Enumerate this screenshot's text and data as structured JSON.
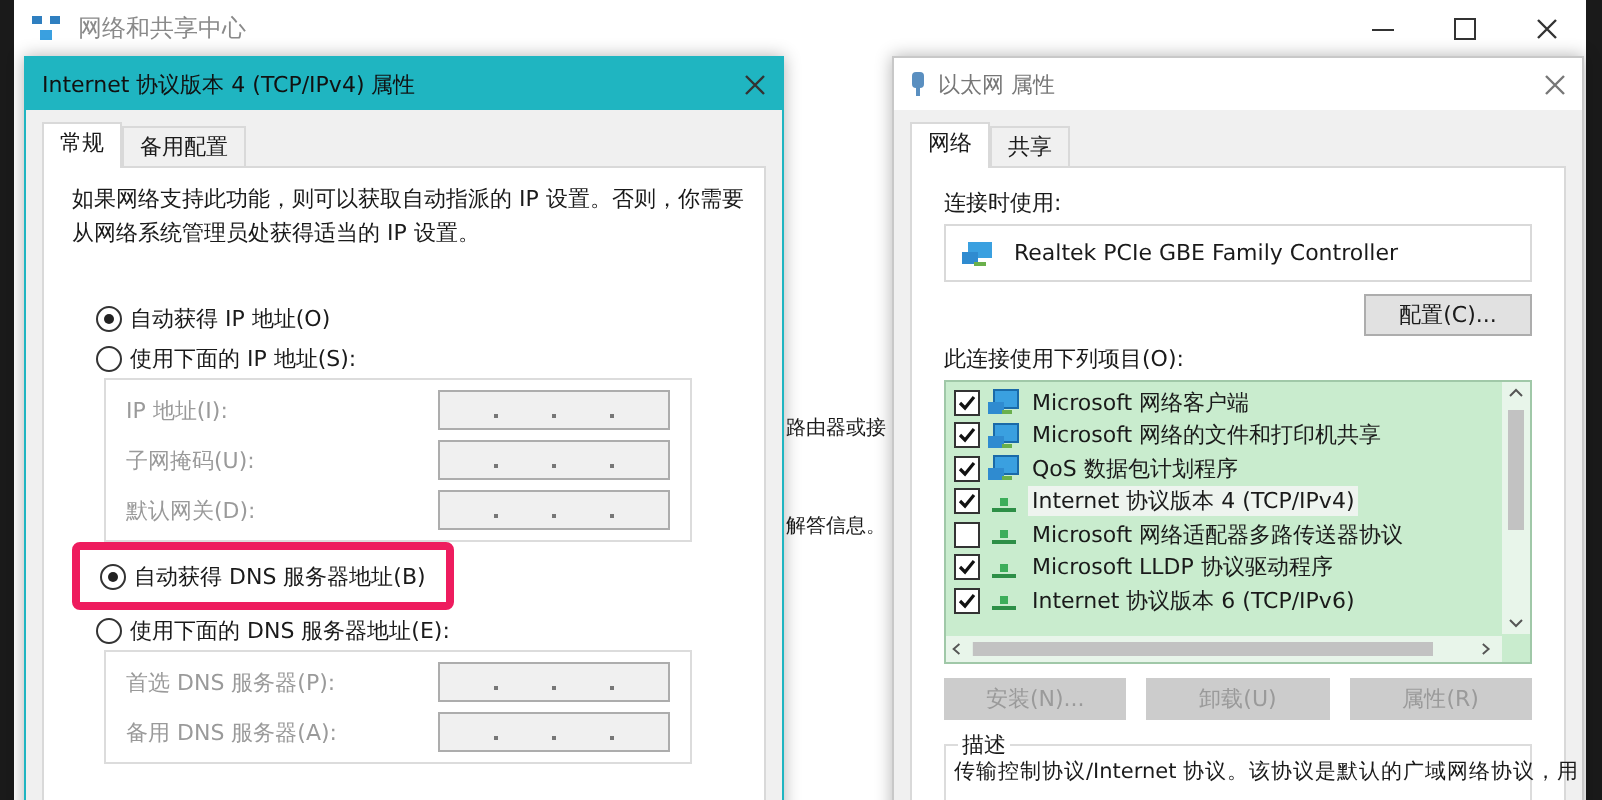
{
  "background_window": {
    "title": "网络和共享中心",
    "snippets": [
      "路由器或接",
      "解答信息。"
    ]
  },
  "ipv4_dialog": {
    "title": "Internet 协议版本 4 (TCP/IPv4) 属性",
    "tabs": [
      {
        "label": "常规",
        "selected": true
      },
      {
        "label": "备用配置",
        "selected": false
      }
    ],
    "intro": "如果网络支持此功能，则可以获取自动指派的 IP 设置。否则，你需要从网络系统管理员处获得适当的 IP 设置。",
    "ip_mode": [
      {
        "label": "自动获得 IP 地址(O)",
        "selected": true,
        "highlighted": false
      },
      {
        "label": "使用下面的 IP 地址(S):",
        "selected": false,
        "highlighted": false
      }
    ],
    "ip_fields": [
      {
        "label": "IP 地址(I):",
        "disabled": true
      },
      {
        "label": "子网掩码(U):",
        "disabled": true
      },
      {
        "label": "默认网关(D):",
        "disabled": true
      }
    ],
    "dns_mode": [
      {
        "label": "自动获得 DNS 服务器地址(B)",
        "selected": true,
        "highlighted": true
      },
      {
        "label": "使用下面的 DNS 服务器地址(E):",
        "selected": false,
        "highlighted": false
      }
    ],
    "dns_fields": [
      {
        "label": "首选 DNS 服务器(P):",
        "disabled": true
      },
      {
        "label": "备用 DNS 服务器(A):",
        "disabled": true
      }
    ]
  },
  "ethernet_dialog": {
    "title": "以太网 属性",
    "tabs": [
      {
        "label": "网络",
        "selected": true
      },
      {
        "label": "共享",
        "selected": false
      }
    ],
    "connect_using_label": "连接时使用:",
    "adapter": "Realtek PCIe GBE Family Controller",
    "configure_button": "配置(C)...",
    "items_label": "此连接使用下列项目(O):",
    "items": [
      {
        "label": "Microsoft 网络客户端",
        "checked": true,
        "selected": false,
        "kind": "client"
      },
      {
        "label": "Microsoft 网络的文件和打印机共享",
        "checked": true,
        "selected": false,
        "kind": "client"
      },
      {
        "label": "QoS 数据包计划程序",
        "checked": true,
        "selected": false,
        "kind": "client"
      },
      {
        "label": "Internet 协议版本 4 (TCP/IPv4)",
        "checked": true,
        "selected": true,
        "kind": "protocol"
      },
      {
        "label": "Microsoft 网络适配器多路传送器协议",
        "checked": false,
        "selected": false,
        "kind": "protocol"
      },
      {
        "label": "Microsoft LLDP 协议驱动程序",
        "checked": true,
        "selected": false,
        "kind": "protocol"
      },
      {
        "label": "Internet 协议版本 6 (TCP/IPv6)",
        "checked": true,
        "selected": false,
        "kind": "protocol"
      }
    ],
    "buttons": [
      {
        "label": "安装(N)...",
        "disabled": true
      },
      {
        "label": "卸载(U)",
        "disabled": true
      },
      {
        "label": "属性(R)",
        "disabled": true
      }
    ],
    "description_title": "描述",
    "description": "传输控制协议/Internet 协议。该协议是默认的广域网络协议，用"
  }
}
